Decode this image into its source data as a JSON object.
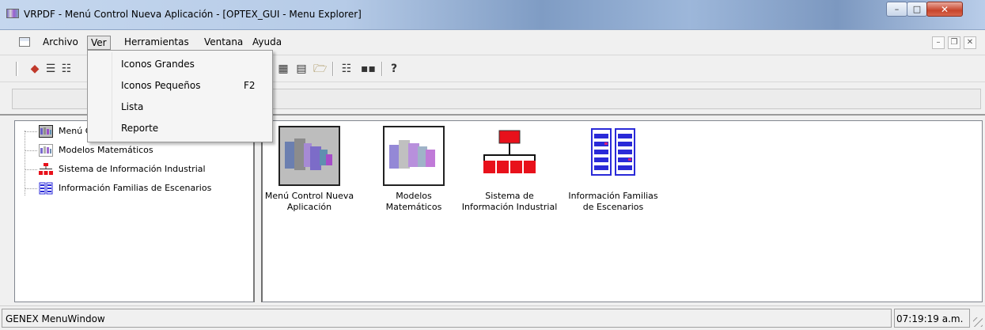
{
  "window": {
    "title": "VRPDF - Menú Control Nueva Aplicación - [OPTEX_GUI - Menu Explorer]",
    "app_icon": "vrpdf-app-icon"
  },
  "menubar": {
    "items": [
      "Archivo",
      "Ver",
      "Herramientas",
      "Ventana",
      "Ayuda"
    ],
    "active": "Ver"
  },
  "ver_menu": {
    "items": [
      {
        "label": "Iconos Grandes",
        "shortcut": ""
      },
      {
        "label": "Iconos Pequeños",
        "shortcut": "F2"
      },
      {
        "label": "Lista",
        "shortcut": ""
      },
      {
        "label": "Reporte",
        "shortcut": ""
      }
    ]
  },
  "toolbar": {
    "icons": [
      "new-item-icon",
      "list-view-icon",
      "details-view-icon",
      "grid-icon",
      "properties-icon",
      "open-folder-icon",
      "tree-icon",
      "large-icons-icon",
      "help-icon"
    ],
    "help_label": "?"
  },
  "tree": {
    "items": [
      {
        "label": "Menú Control Nueva Aplicación",
        "icon": "app-thumbnail-icon"
      },
      {
        "label": "Modelos Matemáticos",
        "icon": "model-thumbnail-icon"
      },
      {
        "label": "Sistema de Información Industrial",
        "icon": "org-chart-icon"
      },
      {
        "label": "Información Familias de Escenarios",
        "icon": "scenario-families-icon"
      }
    ]
  },
  "icons": [
    {
      "line1": "Menú Control Nueva",
      "line2": "Aplicación",
      "icon": "app-thumbnail-icon",
      "selected": true
    },
    {
      "line1": "Modelos",
      "line2": "Matemáticos",
      "icon": "model-thumbnail-icon",
      "selected": false
    },
    {
      "line1": "Sistema de",
      "line2": "Información Industrial",
      "icon": "org-chart-icon",
      "selected": false
    },
    {
      "line1": "Información Familias",
      "line2": "de Escenarios",
      "icon": "scenario-families-icon",
      "selected": false
    }
  ],
  "statusbar": {
    "left": "GENEX MenuWindow",
    "time": "07:19:19 a.m."
  },
  "colors": {
    "org_chart": "#e8111b",
    "scenario_blue": "#2a2ad8",
    "selection_gray": "#bdbdbd"
  }
}
